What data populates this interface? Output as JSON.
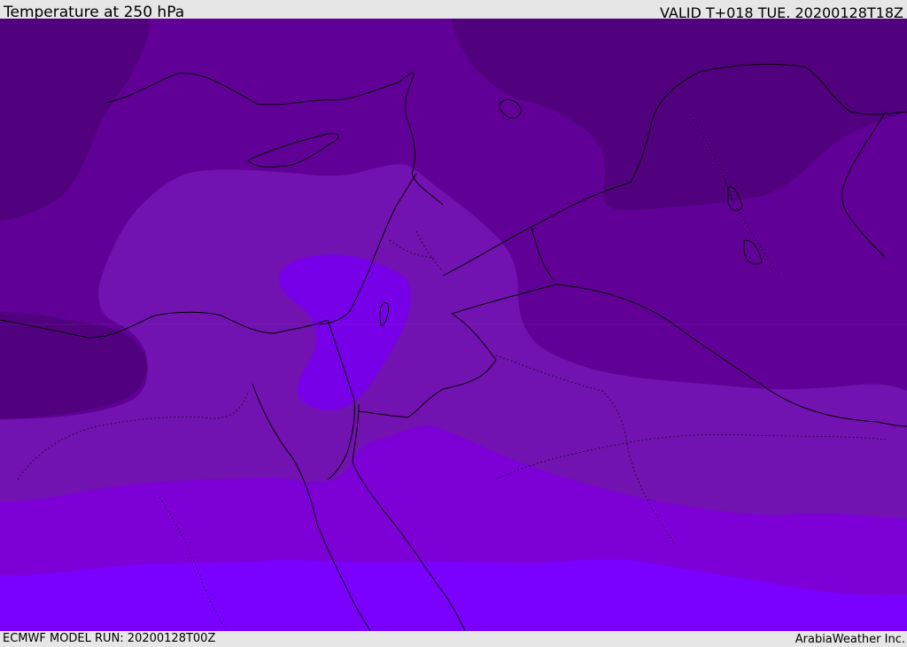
{
  "header": {
    "title": "Temperature at 250 hPa",
    "valid": "VALID T+018 TUE. 20200128T18Z"
  },
  "footer": {
    "model_run": "ECMWF MODEL RUN: 20200128T00Z",
    "brand": "ArabiaWeather Inc."
  },
  "colors": {
    "band_darkest": "#51007e",
    "band_dark": "#610096",
    "band_mid": "#7212b0",
    "band_violet": "#7d00d6",
    "band_bright": "#7a00ff",
    "pocket": "#7700e8",
    "coast": "#000000",
    "bar_bg": "#e6e6e6"
  }
}
